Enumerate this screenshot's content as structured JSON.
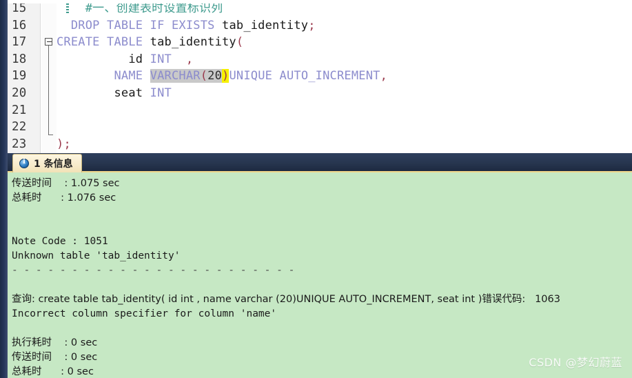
{
  "editor": {
    "lines": [
      {
        "num": "15",
        "fold": false,
        "marker": true,
        "tokens": [
          {
            "t": "    ",
            "c": "ident"
          },
          {
            "t": "#一、创建表时设置标识列",
            "c": "cmt"
          }
        ]
      },
      {
        "num": "16",
        "fold": false,
        "marker": false,
        "tokens": [
          {
            "t": "  ",
            "c": "ident"
          },
          {
            "t": "DROP TABLE IF EXISTS",
            "c": "kw"
          },
          {
            "t": " tab_identity",
            "c": "ident"
          },
          {
            "t": ";",
            "c": "punct"
          }
        ]
      },
      {
        "num": "17",
        "fold": true,
        "marker": false,
        "tokens": [
          {
            "t": "CREATE TABLE",
            "c": "kw"
          },
          {
            "t": " tab_identity",
            "c": "ident"
          },
          {
            "t": "(",
            "c": "punct"
          }
        ]
      },
      {
        "num": "18",
        "fold": false,
        "marker": false,
        "tokens": [
          {
            "t": "          id ",
            "c": "ident"
          },
          {
            "t": "INT",
            "c": "kw"
          },
          {
            "t": "  ",
            "c": "ident"
          },
          {
            "t": ",",
            "c": "punct"
          }
        ]
      },
      {
        "num": "19",
        "fold": false,
        "marker": false,
        "tokens": [
          {
            "t": "        ",
            "c": "ident"
          },
          {
            "t": "NAME ",
            "c": "kw"
          },
          {
            "t": "VARCHAR",
            "c": "kw sel"
          },
          {
            "t": "(",
            "c": "punct sel"
          },
          {
            "t": "20",
            "c": "num sel"
          },
          {
            "t": ")",
            "c": "bracket-hl"
          },
          {
            "t": "UNIQUE AUTO_INCREMENT",
            "c": "kw"
          },
          {
            "t": ",",
            "c": "punct"
          }
        ]
      },
      {
        "num": "20",
        "fold": false,
        "marker": false,
        "tokens": [
          {
            "t": "        seat ",
            "c": "ident"
          },
          {
            "t": "INT",
            "c": "kw"
          }
        ]
      },
      {
        "num": "21",
        "fold": false,
        "marker": false,
        "tokens": []
      },
      {
        "num": "22",
        "fold": false,
        "marker": false,
        "tokens": []
      },
      {
        "num": "23",
        "fold": false,
        "marker": false,
        "tokens": [
          {
            "t": ")",
            "c": "punct"
          },
          {
            "t": ";",
            "c": "punct"
          }
        ]
      }
    ]
  },
  "results": {
    "tab": {
      "icon": "info-icon",
      "label": "1 条信息"
    },
    "messages": [
      {
        "id": "transfer-time-1",
        "text": "传送时间    : 1.075 sec",
        "cjk": true
      },
      {
        "id": "total-time-1",
        "text": "总耗时      : 1.076 sec",
        "cjk": true
      },
      {
        "id": "blank-1",
        "text": "",
        "cjk": false
      },
      {
        "id": "blank-2",
        "text": "",
        "cjk": false
      },
      {
        "id": "note-code",
        "text": "Note Code : 1051",
        "cjk": false
      },
      {
        "id": "unknown-table",
        "text": "Unknown table 'tab_identity'",
        "cjk": false
      },
      {
        "id": "rule",
        "text": "-  -  -  -  -  -  -  -  -  -  -  -  -  -  -  -  -  -  -  -  -  -  -  -  -  -  -  -  -  -  -  -  -  -  -  -",
        "cjk": false
      },
      {
        "id": "blank-3",
        "text": "",
        "cjk": false
      },
      {
        "id": "query-line",
        "text": "查询: create table tab_identity( id int , name varchar (20)UNIQUE AUTO_INCREMENT, seat int )错误代码:   1063",
        "cjk": true
      },
      {
        "id": "incorrect-column",
        "text": "Incorrect column specifier for column 'name'",
        "cjk": false
      },
      {
        "id": "blank-4",
        "text": "",
        "cjk": false
      },
      {
        "id": "exec-time-2",
        "text": "执行耗时    : 0 sec",
        "cjk": true
      },
      {
        "id": "transfer-time-2",
        "text": "传送时间    : 0 sec",
        "cjk": true
      },
      {
        "id": "total-time-2",
        "text": "总耗时      : 0 sec",
        "cjk": true
      }
    ]
  },
  "watermark": {
    "text": "CSDN @梦幻蔚蓝"
  },
  "colors": {
    "keyword": "#8c8ccd",
    "comment": "#3f9b8e",
    "punctuation": "#9b3b4e",
    "selection": "#c9c9c9",
    "bracket_match": "#f6f000",
    "results_bg": "#c6e8c4",
    "tabbar_bg": "#27364f",
    "tab_bg": "#f7ebcb"
  }
}
